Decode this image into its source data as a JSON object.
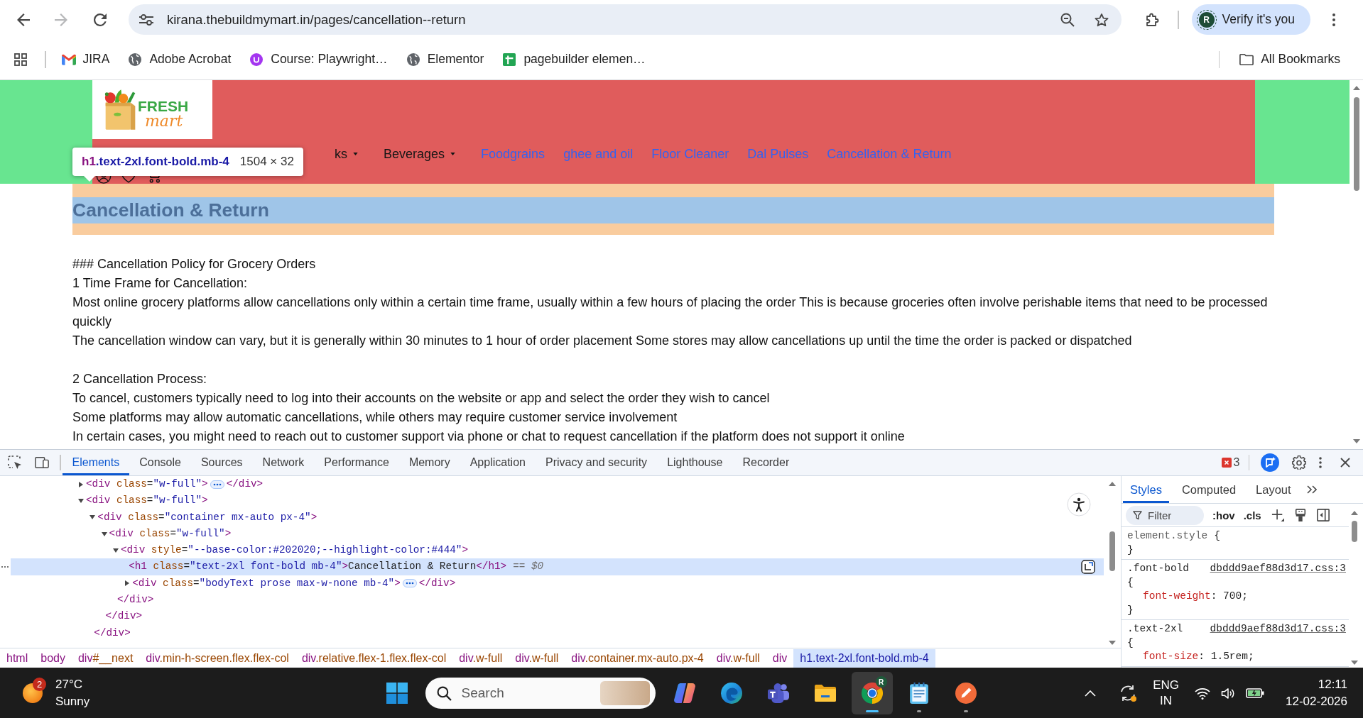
{
  "browser": {
    "nav_buttons": [
      {
        "kind": "back",
        "disabled": false
      },
      {
        "kind": "forward",
        "disabled": true
      },
      {
        "kind": "reload",
        "disabled": false
      }
    ],
    "url": "kirana.thebuildmymart.in/pages/cancellation--return",
    "profile": {
      "initial": "R",
      "label": "Verify it's you"
    }
  },
  "bookmarks": {
    "items": [
      {
        "kind": "mail",
        "label": "JIRA"
      },
      {
        "kind": "globe",
        "label": "Adobe Acrobat"
      },
      {
        "kind": "course",
        "label": "Course: Playwright…"
      },
      {
        "kind": "globe",
        "label": "Elementor"
      },
      {
        "kind": "sheet",
        "label": "pagebuilder elemen…"
      }
    ],
    "all_bookmarks": "All Bookmarks"
  },
  "page": {
    "logo": {
      "word_1": "FRESH",
      "word_2": "mart"
    },
    "nav": [
      {
        "kind": "dropdown",
        "label": "ks"
      },
      {
        "kind": "dropdown",
        "label": "Beverages"
      },
      {
        "kind": "link",
        "label": "Foodgrains"
      },
      {
        "kind": "link",
        "label": "ghee and oil"
      },
      {
        "kind": "link",
        "label": "Floor Cleaner"
      },
      {
        "kind": "link",
        "label": "Dal Pulses"
      },
      {
        "kind": "link",
        "label": "Cancellation & Return"
      }
    ],
    "inspect_tooltip": {
      "selector": "h1.text-2xl.font-bold.mb-4",
      "size": "1504 × 32"
    },
    "heading": "Cancellation & Return",
    "sections": [
      {
        "lines": [
          "### Cancellation Policy for Grocery Orders",
          "1 Time Frame for Cancellation:",
          "Most online grocery platforms allow cancellations only within a certain time frame, usually within a few hours of placing the order This is because groceries often involve perishable items that need to be processed quickly",
          "The cancellation window can vary, but it is generally within 30 minutes to 1 hour of order placement Some stores may allow cancellations up until the time the order is packed or dispatched"
        ]
      },
      {
        "lines": [
          "2 Cancellation Process:",
          "To cancel, customers typically need to log into their accounts on the website or app and select the order they wish to cancel",
          "Some platforms may allow automatic cancellations, while others may require customer service involvement",
          "In certain cases, you might need to reach out to customer support via phone or chat to request cancellation if the platform does not support it online"
        ]
      }
    ]
  },
  "devtools": {
    "tabs": [
      {
        "label": "Elements",
        "selected": true
      },
      {
        "label": "Console",
        "selected": false
      },
      {
        "label": "Sources",
        "selected": false
      },
      {
        "label": "Network",
        "selected": false
      },
      {
        "label": "Performance",
        "selected": false
      },
      {
        "label": "Memory",
        "selected": false
      },
      {
        "label": "Application",
        "selected": false
      },
      {
        "label": "Privacy and security",
        "selected": false
      },
      {
        "label": "Lighthouse",
        "selected": false
      },
      {
        "label": "Recorder",
        "selected": false
      }
    ],
    "error_count": "3",
    "dom_tree": [
      {
        "kind": "node",
        "open": "<div class=\"w-full\">",
        "close": "</div>",
        "expanded": false,
        "selected": false
      },
      {
        "kind": "node",
        "open": "<div class=\"w-full\">",
        "expanded": true,
        "selected": false,
        "children": [
          {
            "kind": "node",
            "open": "<div class=\"container mx-auto px-4\">",
            "close": "</div>",
            "expanded": true,
            "selected": false,
            "children": [
              {
                "kind": "node",
                "open": "<div class=\"w-full\">",
                "close": "</div>",
                "expanded": true,
                "selected": false,
                "children": [
                  {
                    "kind": "node",
                    "open": "<div style=\"--base-color:#202020;--highlight-color:#444\">",
                    "close": "</div>",
                    "expanded": true,
                    "selected": false,
                    "children": [
                      {
                        "kind": "leaf",
                        "open": "<h1 class=\"text-2xl font-bold mb-4\">Cancellation & Return</h1>",
                        "console_ref": "== $0",
                        "selected": true
                      },
                      {
                        "kind": "node",
                        "open": "<div class=\"bodyText prose max-w-none mb-4\">",
                        "close": "</div>",
                        "expanded": false,
                        "selected": false
                      }
                    ]
                  }
                ]
              }
            ]
          }
        ]
      }
    ],
    "breadcrumbs": [
      {
        "label": "html",
        "selected": false
      },
      {
        "label": "body",
        "selected": false
      },
      {
        "label": "div#__next",
        "selected": false
      },
      {
        "label": "div.min-h-screen.flex.flex-col",
        "selected": false
      },
      {
        "label": "div.relative.flex-1.flex.flex-col",
        "selected": false
      },
      {
        "label": "div.w-full",
        "selected": false
      },
      {
        "label": "div.w-full",
        "selected": false
      },
      {
        "label": "div.container.mx-auto.px-4",
        "selected": false
      },
      {
        "label": "div.w-full",
        "selected": false
      },
      {
        "label": "div",
        "selected": false
      },
      {
        "label": "h1.text-2xl.font-bold.mb-4",
        "selected": true
      }
    ],
    "styles": {
      "tabs": [
        {
          "label": "Styles",
          "selected": true
        },
        {
          "label": "Computed",
          "selected": false
        },
        {
          "label": "Layout",
          "selected": false
        }
      ],
      "filter": {
        "placeholder": "Filter"
      },
      "toggles": [
        ":hov",
        ".cls"
      ],
      "rules": [
        {
          "selector": "element.style",
          "open": "{",
          "close": "}"
        },
        {
          "selector": ".font-bold",
          "source": "dbddd9aef88d3d17.css:3",
          "open": "{",
          "declarations": [
            "font-weight: 700;"
          ],
          "close": "}"
        },
        {
          "selector": ".text-2xl",
          "source": "dbddd9aef88d3d17.css:3",
          "open": "{",
          "declarations": [
            "font-size: 1.5rem;"
          ]
        }
      ]
    }
  },
  "taskbar": {
    "weather": {
      "badge": "2",
      "temperature": "27°C",
      "condition": "Sunny"
    },
    "search": {
      "placeholder": "Search"
    },
    "apps": [
      {
        "kind": "copilot",
        "selected": false,
        "running": false
      },
      {
        "kind": "edge",
        "selected": false,
        "running": false
      },
      {
        "kind": "teams",
        "selected": false,
        "running": false
      },
      {
        "kind": "explorer",
        "selected": false,
        "running": false
      },
      {
        "kind": "chrome",
        "selected": true,
        "running": true,
        "badge": "R"
      },
      {
        "kind": "notepad",
        "selected": false,
        "running": true
      },
      {
        "kind": "pen",
        "selected": false,
        "running": true
      }
    ],
    "language": {
      "line_1": "ENG",
      "line_2": "IN"
    },
    "clock": {
      "time": "12:11",
      "date": "12-02-2026"
    }
  }
}
